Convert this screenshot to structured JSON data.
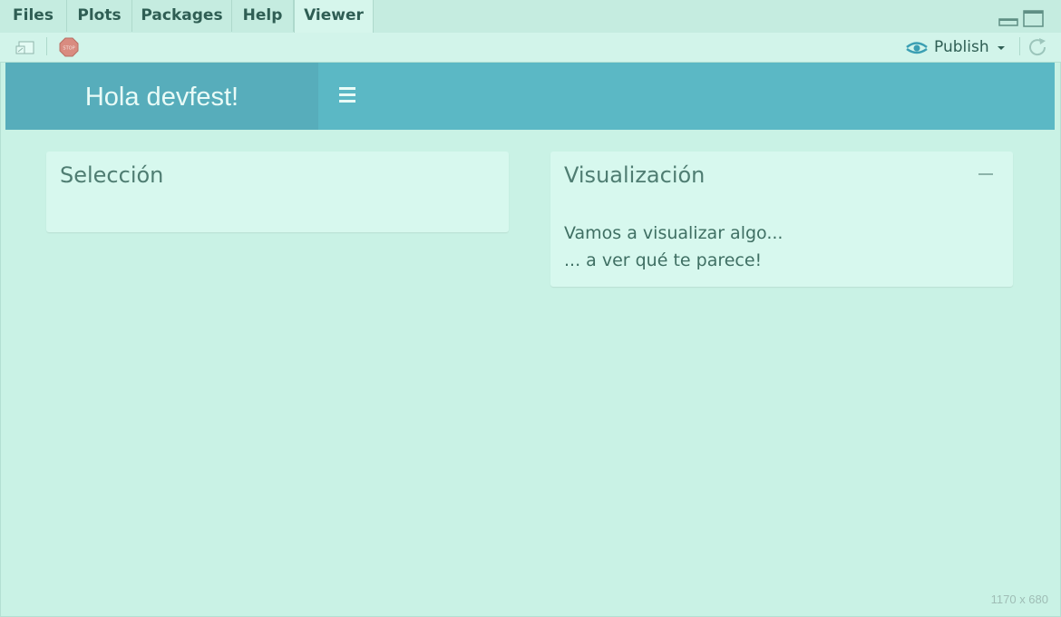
{
  "tabs": [
    {
      "label": "Files",
      "active": false
    },
    {
      "label": "Plots",
      "active": false
    },
    {
      "label": "Packages",
      "active": false
    },
    {
      "label": "Help",
      "active": false
    },
    {
      "label": "Viewer",
      "active": true
    }
  ],
  "toolbar": {
    "icons": [
      "export-icon",
      "stop-icon",
      "refresh-icon"
    ],
    "publish_label": "Publish"
  },
  "dashboard": {
    "title": "Hola devfest!",
    "header_color": "#5bb8c5"
  },
  "boxes": {
    "seleccion": {
      "title": "Selección"
    },
    "visualizacion": {
      "title": "Visualización",
      "line1": "Vamos a visualizar algo...",
      "line2": "... a ver qué te parece!"
    }
  },
  "viewer_size": "1170 x 680"
}
